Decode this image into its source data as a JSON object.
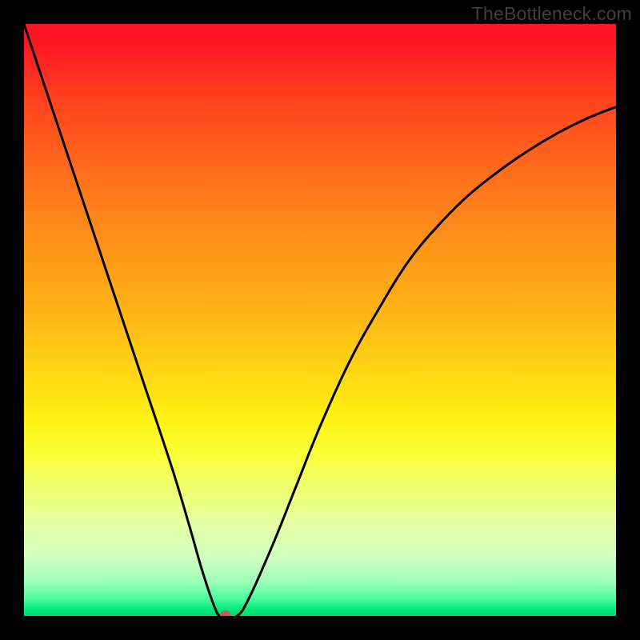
{
  "watermark": "TheBottleneck.com",
  "chart_data": {
    "type": "line",
    "title": "",
    "xlabel": "",
    "ylabel": "",
    "xlim": [
      0,
      100
    ],
    "ylim": [
      0,
      100
    ],
    "series": [
      {
        "name": "curve",
        "x": [
          0,
          5,
          10,
          15,
          20,
          25,
          28,
          30,
          32,
          33,
          34,
          36,
          38,
          42,
          46,
          50,
          55,
          60,
          65,
          70,
          75,
          80,
          85,
          90,
          95,
          100
        ],
        "y": [
          100,
          85,
          70,
          55,
          40,
          25,
          15,
          8,
          2,
          0,
          0,
          0,
          3,
          12,
          22,
          32,
          43,
          52,
          60,
          66,
          71,
          75,
          78.5,
          81.5,
          84,
          86
        ]
      }
    ],
    "marker": {
      "x": 34,
      "y": 0,
      "color": "#c85b55"
    },
    "background_gradient": {
      "type": "vertical",
      "stops": [
        {
          "pos": 0.0,
          "color": "#fe1522"
        },
        {
          "pos": 0.5,
          "color": "#ffc015"
        },
        {
          "pos": 0.7,
          "color": "#fff010"
        },
        {
          "pos": 0.9,
          "color": "#d0ffc0"
        },
        {
          "pos": 1.0,
          "color": "#00d86c"
        }
      ]
    }
  }
}
